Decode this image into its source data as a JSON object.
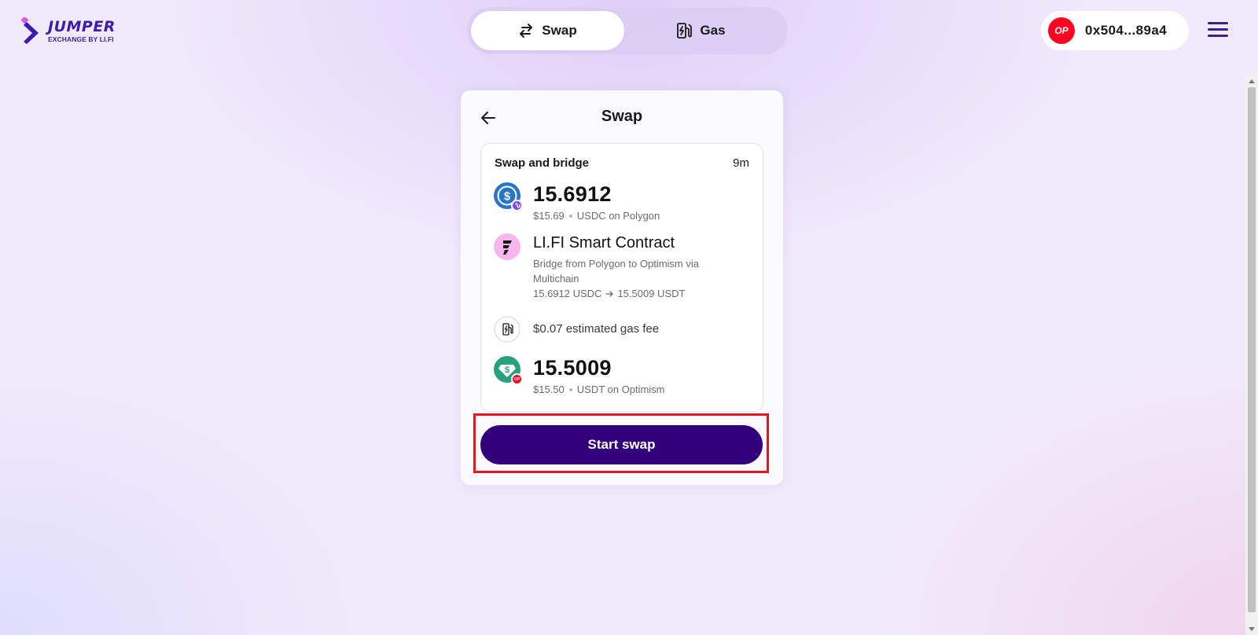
{
  "header": {
    "logo_word": "JUMPER",
    "logo_sub": "EXCHANGE BY LI.FI",
    "tabs": [
      {
        "label": "Swap",
        "icon": "swap-arrows-icon",
        "active": true
      },
      {
        "label": "Gas",
        "icon": "gas-pump-icon",
        "active": false
      }
    ],
    "wallet": {
      "chain_badge": "OP",
      "address": "0x504...89a4"
    }
  },
  "card": {
    "title": "Swap",
    "route": {
      "title": "Swap and bridge",
      "duration": "9m",
      "from": {
        "amount": "15.6912",
        "usd": "$15.69",
        "token": "USDC on Polygon",
        "icon": "usdc-token-icon",
        "chain_icon": "polygon-chain-icon"
      },
      "contract": {
        "name": "LI.FI Smart Contract",
        "description": "Bridge from Polygon to Optimism via Multichain",
        "conversion_from": "15.6912 USDC",
        "conversion_to": "15.5009 USDT",
        "icon": "lifi-logo-icon"
      },
      "gas": {
        "text": "$0.07 estimated gas fee",
        "icon": "gas-pump-icon"
      },
      "to": {
        "amount": "15.5009",
        "usd": "$15.50",
        "token": "USDT on Optimism",
        "icon": "usdt-token-icon",
        "chain_icon": "optimism-chain-icon",
        "chain_badge": "OP"
      }
    },
    "start_button": "Start swap"
  },
  "colors": {
    "brand": "#31007a",
    "logo": "#3f1ab0",
    "optimism": "#ff0420",
    "usdc": "#2775ca",
    "usdt": "#26a17b",
    "polygon": "#8247e5",
    "lifi_bg": "#f5b5ee",
    "highlight": "#e8141f"
  }
}
